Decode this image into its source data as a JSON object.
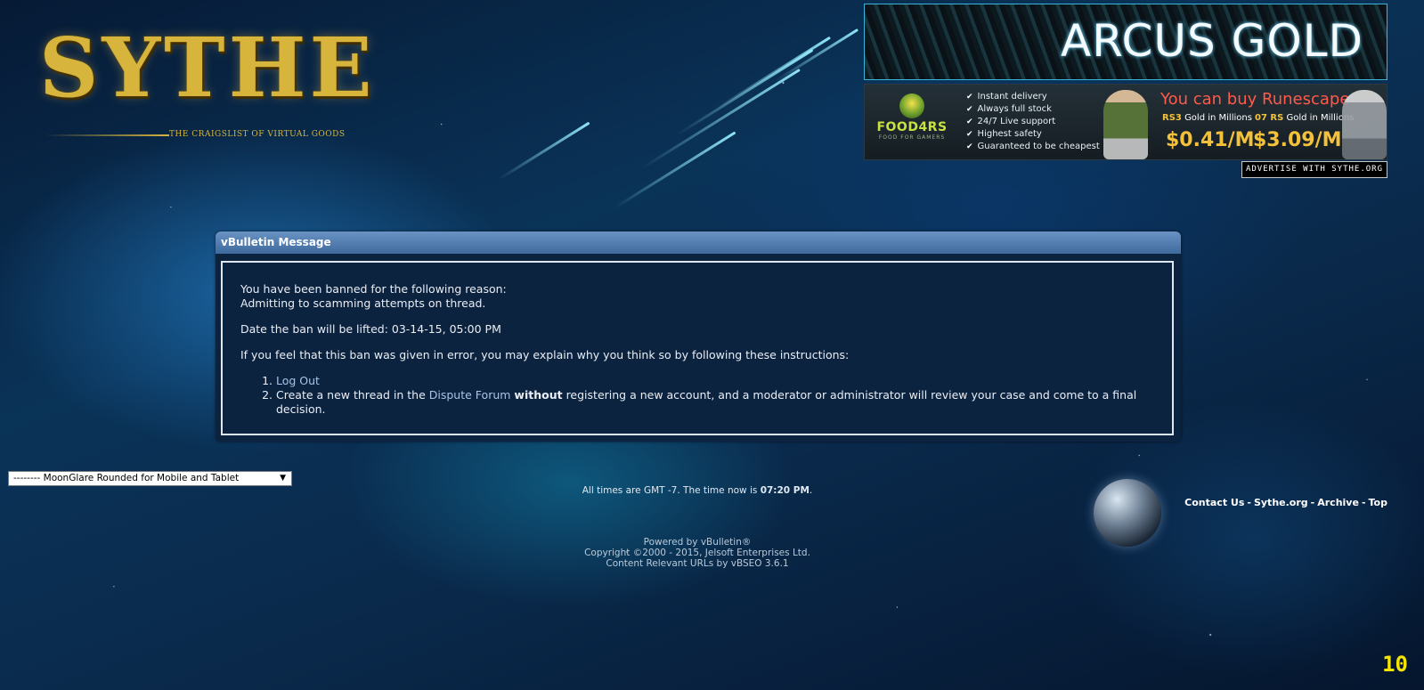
{
  "logo": {
    "wordmark": "SYTHE",
    "tagline": "THE CRAIGSLIST OF VIRTUAL GOODS"
  },
  "ads": {
    "top_banner": "ARCUS GOLD",
    "food_logo": "FOOD4RS",
    "food_sub": "FOOD FOR GAMERS",
    "features": [
      "Instant delivery",
      "Always full stock",
      "24/7 Live support",
      "Highest safety",
      "Guaranteed to be cheapest"
    ],
    "headline": "You can buy Runescape",
    "rs3_tag": "RS3",
    "rs3_label": "Gold in Millions",
    "rs07_tag": "07 RS",
    "rs07_label": "Gold in Millions",
    "rs3_price": "$0.41/M",
    "rs07_price": "$3.09/M",
    "advertise_label": "ADVERTISE WITH SYTHE.ORG"
  },
  "message": {
    "title": "vBulletin Message",
    "line1": "You have been banned for the following reason:",
    "line2": "Admitting to scamming attempts on thread.",
    "ban_lift": "Date the ban will be lifted: 03-14-15, 05:00 PM",
    "instructions_intro": "If you feel that this ban was given in error, you may explain why you think so by following these instructions:",
    "step1": "Log Out",
    "step2_pre": "Create a new thread in the ",
    "step2_link": "Dispute Forum",
    "step2_bold": "without",
    "step2_post": " registering a new account, and a moderator or administrator will review your case and come to a final decision."
  },
  "style_select": {
    "selected": "-------- MoonGlare Rounded for Mobile and Tablet",
    "arrow": "▼"
  },
  "footer": {
    "time_pre": "All times are GMT -7. The time now is ",
    "time_value": "07:20 PM",
    "time_post": ".",
    "links": [
      "Contact Us",
      "Sythe.org",
      "Archive",
      "Top"
    ],
    "separator": "-",
    "copyright1": "Powered by vBulletin®",
    "copyright2": "Copyright ©2000 - 2015, Jelsoft Enterprises Ltd.",
    "copyright3": "Content Relevant URLs by vBSEO 3.6.1"
  },
  "overlay": {
    "fps_counter": "10"
  }
}
